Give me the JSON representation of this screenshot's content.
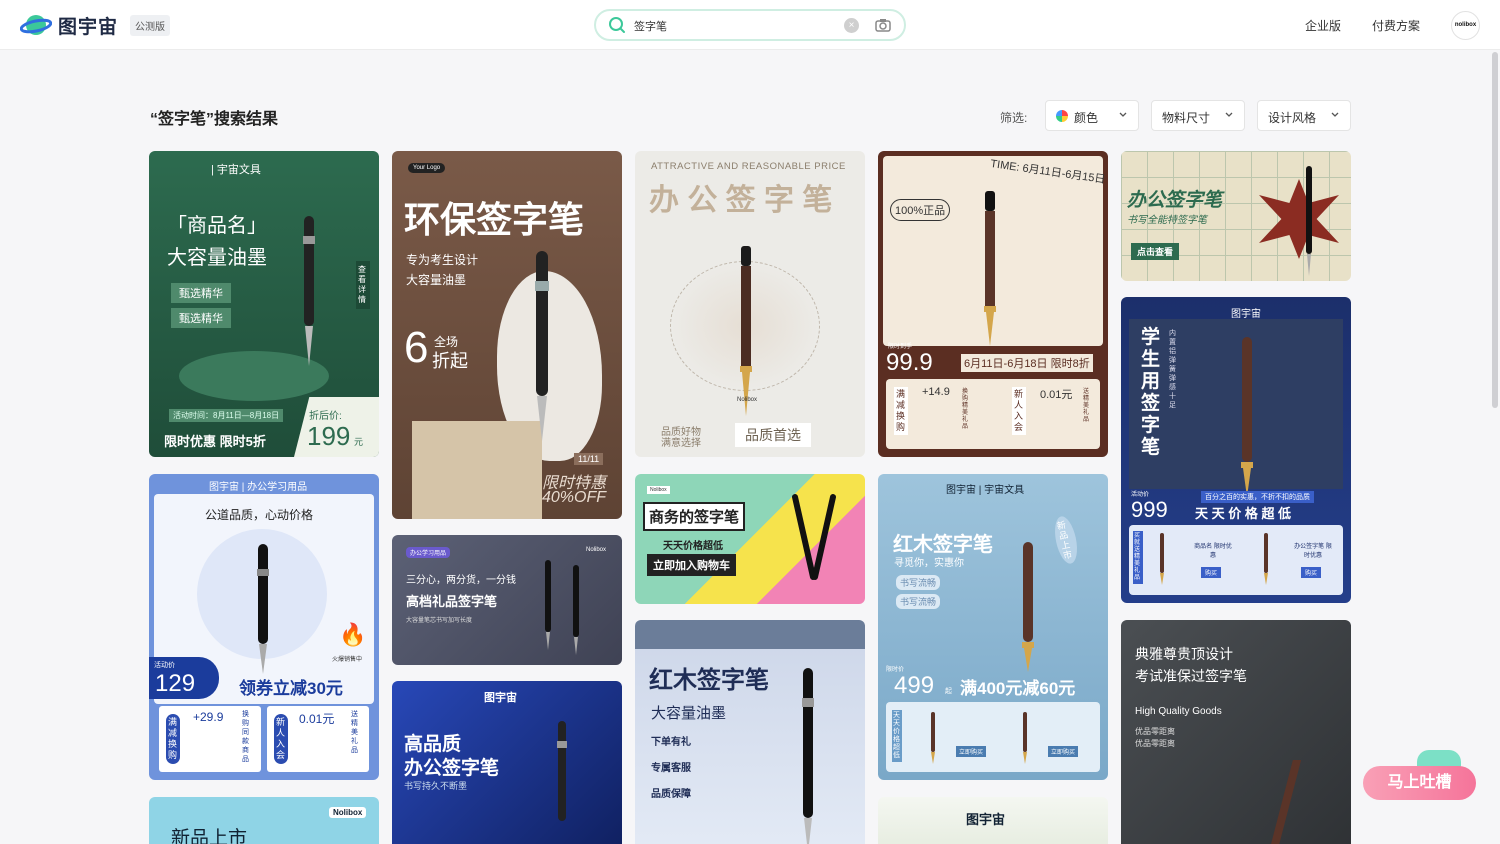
{
  "header": {
    "brand": "图宇宙",
    "badge": "公测版",
    "search_value": "签字笔",
    "links": [
      "企业版",
      "付费方案"
    ],
    "avatar": "nolibox"
  },
  "results": {
    "title": "“签字笔”搜索结果",
    "filter_label": "筛选:",
    "filters": [
      "颜色",
      "物料尺寸",
      "设计风格"
    ]
  },
  "cards": {
    "c1": {
      "brand": "| 宇宙文具",
      "line1": "「商品名」",
      "line2": "大容量油墨",
      "tag1": "甄选精华",
      "tag2": "甄选精华",
      "side": "查看详情",
      "date": "活动时间：8月11日—8月18日",
      "promo": "限时优惠 限时5折",
      "after": "折后价:",
      "price": "199",
      "unit": "元"
    },
    "c2": {
      "logo": "Your Logo",
      "title": "环保签字笔",
      "sub1": "专为考生设计",
      "sub2": "大容量油墨",
      "big": "6",
      "all": "全场",
      "off": "折起",
      "date": "11/11",
      "limit": "限时特惠",
      "pct": "40%OFF"
    },
    "c3": {
      "eng": "ATTRACTIVE AND REASONABLE PRICE",
      "title": "办 公 签 字 笔",
      "brand": "Nolibox",
      "l1": "品质好物",
      "l2": "满意选择",
      "best": "品质首选"
    },
    "c4": {
      "time": "TIME: 6月11日-6月15日",
      "genuine": "100%正品",
      "label": "限时到手",
      "price": "99.9",
      "range": "6月11日-6月18日 限时8折",
      "g1": "满减换购",
      "p1": "+14.9",
      "d1": "换购精美礼品",
      "g2": "新人入会",
      "p2": "0.01元",
      "d2": "送精美礼品"
    },
    "c5": {
      "title": "办公签字笔",
      "sub": "书写全能特签字笔",
      "btn": "点击查看"
    },
    "c6": {
      "brand": "图宇宙",
      "title": "学生用签字笔",
      "side": "内置铝弹簧弹感十足",
      "label": "活动价",
      "price": "999",
      "note": "百分之百的实惠，不折不扣的品质",
      "slogan": "天 天 价 格 超 低",
      "side2": "买就送精美礼品",
      "i1": "商品名 限时优惠",
      "i2": "办公签字笔 限时优惠",
      "btn": "购买"
    },
    "c7": {
      "brand": "图宇宙 | 办公学习用品",
      "slogan": "公道品质，心动价格",
      "hot": "火爆销售中",
      "label": "活动价",
      "price": "129",
      "coupon": "领券立减30元",
      "g1": "满减换购",
      "p1": "+29.9",
      "d1": "换购同款商品",
      "g2": "新人入会",
      "p2": "0.01元",
      "d2": "送精美礼品"
    },
    "c8": {
      "tag": "办公学习用品",
      "brand": "Nolibox",
      "l1": "三分心，两分货，一分钱",
      "l2": "高档礼品签字笔",
      "l3": "大容量笔芯书写加写长度"
    },
    "c9": {
      "brand": "Nolibox",
      "title": "商务的签字笔",
      "sub": "天天价格超低",
      "btn": "立即加入购物车"
    },
    "c10": {
      "brand": "图宇宙 | 宇宙文具",
      "title": "红木签字笔",
      "sub": "寻觅你，实惠你",
      "tag1": "书写流畅",
      "tag2": "书写流畅",
      "badge": "新品上市",
      "label": "限时价",
      "price": "499",
      "qi": "起",
      "promo": "满400元减60元",
      "side": "天天价格超低",
      "btn": "立即购买"
    },
    "c11": {
      "title": "典雅尊贵顶设计",
      "sub": "考试准保过签字笔",
      "eng": "High Quality Goods",
      "l1": "优品零距离",
      "l2": "优品零距离"
    },
    "c12": {
      "brand": "图宇宙",
      "title": "高品质",
      "title2": "办公签字笔",
      "sub": "书写持久不断墨"
    },
    "c13": {
      "title": "红木签字笔",
      "sub": "大容量油墨",
      "f1": "下单有礼",
      "f2": "专属客服",
      "f3": "品质保障"
    },
    "c14": {
      "brand": "Nolibox",
      "title": "新品上市"
    },
    "c15": {
      "brand": "图宇宙"
    }
  },
  "feedback": "马上吐槽"
}
